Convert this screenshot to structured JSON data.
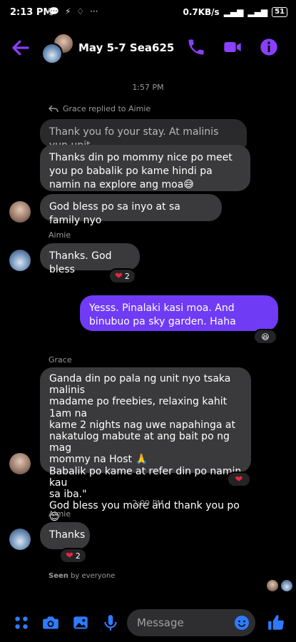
{
  "status_bar": {
    "time": "2:13 PM",
    "speed": "0.7KB/s",
    "battery": "51",
    "more": "···"
  },
  "header": {
    "title": "May 5-7 Sea625"
  },
  "colors": {
    "accent": "#8a3ffc",
    "my_bubble": "#6f3bf5",
    "heart": "#e8263b"
  },
  "chat": {
    "timestamp_1": "1:57 PM",
    "reply_label": "Grace replied to Aimie",
    "quoted_message": "Thank you fo your stay. At malinis yun unit.",
    "msg_grace_1": "Thanks din po mommy nice po meet you po babalik po kame hindi pa namin na explore ang moa😅",
    "msg_grace_2": "God bless po sa inyo at sa family nyo",
    "sender_aimie_1": "Aimie",
    "msg_aimie_1": "Thanks. God bless",
    "reaction_1": "2",
    "msg_me_1": "Yesss. Pinalaki kasi moa. And binubuo pa sky garden. Haha",
    "reaction_me": "😆",
    "sender_grace": "Grace",
    "msg_grace_3_lines": [
      "Ganda din po pala ng unit nyo tsaka malinis",
      "madame po freebies, relaxing kahit 1am na",
      "kame 2 nights nag uwe napahinga at",
      "nakatulog mabute at ang bait po ng mag",
      "mommy na Host 🙏",
      "Babalik po kame at refer din po namin kau",
      "sa iba.\"",
      "God bless you more and thank you po 😊"
    ],
    "timestamp_2": "2:09 PM",
    "sender_aimie_2": "Aimie",
    "msg_aimie_2": "Thanks",
    "reaction_2": "2",
    "seen_prefix": "Seen",
    "seen_suffix": "by everyone"
  },
  "composer": {
    "placeholder": "Message"
  }
}
